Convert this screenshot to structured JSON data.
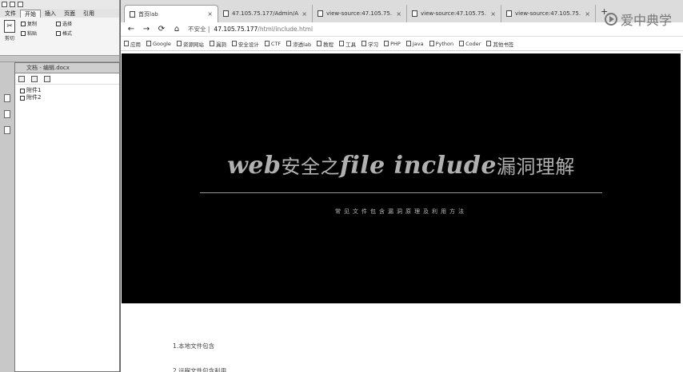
{
  "app": {
    "menu_tabs": [
      "文件",
      "开始",
      "插入",
      "页面",
      "引用"
    ],
    "ribbon": {
      "big_label": "剪切",
      "small_labels": [
        "复制",
        "粘贴"
      ],
      "right_labels": [
        "选择",
        "格式"
      ]
    },
    "doc_tab": "文档 - 编辑.docx",
    "tree": [
      "附件1",
      "附件2"
    ]
  },
  "browser": {
    "tabs": [
      {
        "title": "首页lab"
      },
      {
        "title": "47.105.75.177/Admin/Ac"
      },
      {
        "title": "view-source:47.105.75.17"
      },
      {
        "title": "view-source:47.105.75.17"
      },
      {
        "title": "view-source:47.105.75.17"
      }
    ],
    "new_tab": "+",
    "watermark": "爱中典学",
    "nav": {
      "back": "←",
      "forward": "→",
      "reload": "⟳",
      "home": "⌂"
    },
    "omnibox": {
      "security": "不安全 |",
      "host": "47.105.75.177",
      "path": "/html/include.html"
    },
    "bookmarks": [
      "应用",
      "Google",
      "资源网站",
      "漏洞",
      "安全设计",
      "CTF",
      "渗透lab",
      "教程",
      "工具",
      "学习",
      "PHP",
      "Java",
      "Python",
      "Coder",
      "其他书签"
    ]
  },
  "page": {
    "hero_title_latin1": "web",
    "hero_title_cjk1": "安全之",
    "hero_title_latin2": "file include",
    "hero_title_cjk2": "漏洞理解",
    "hero_subtitle": "常见文件包含漏洞原理及利用方法",
    "toc": [
      "1.本地文件包含",
      "2.远程文件包含利用"
    ]
  }
}
